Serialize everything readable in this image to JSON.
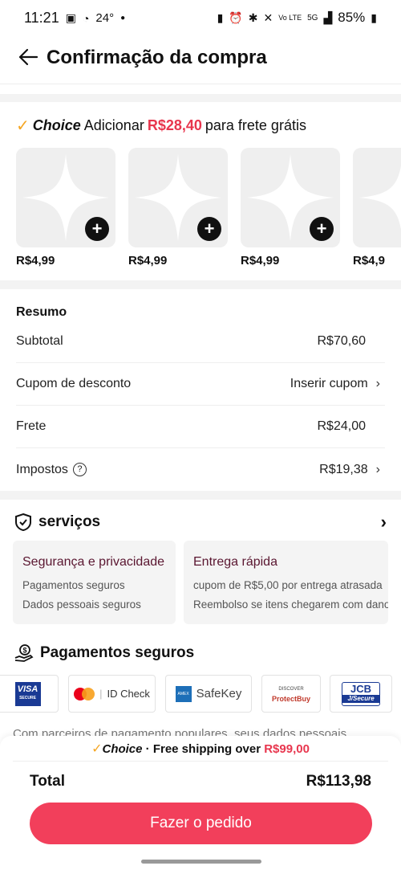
{
  "status_bar": {
    "time": "11:21",
    "temperature": "24°",
    "battery": "85%",
    "network": "5G"
  },
  "header": {
    "title": "Confirmação da compra"
  },
  "choice_banner": {
    "brand": "Choice",
    "prefix": "Adicionar",
    "amount": "R$28,40",
    "suffix": "para frete grátis"
  },
  "products": [
    {
      "price": "R$4,99"
    },
    {
      "price": "R$4,99"
    },
    {
      "price": "R$4,99"
    },
    {
      "price": "R$4,9"
    }
  ],
  "summary": {
    "title": "Resumo",
    "rows": [
      {
        "label": "Subtotal",
        "value": "R$70,60"
      },
      {
        "label": "Cupom de desconto",
        "value": "Inserir cupom"
      },
      {
        "label": "Frete",
        "value": "R$24,00"
      },
      {
        "label": "Impostos",
        "value": "R$19,38"
      }
    ]
  },
  "services": {
    "title": "serviços",
    "cards": [
      {
        "title": "Segurança e privacidade",
        "lines": [
          "Pagamentos seguros",
          "Dados pessoais seguros"
        ]
      },
      {
        "title": "Entrega rápida",
        "lines": [
          "cupom de R$5,00 por entrega atrasada",
          "Reembolso se itens chegarem com dano"
        ]
      }
    ]
  },
  "payments": {
    "title": "Pagamentos seguros",
    "logos": {
      "visa": "VISA",
      "visa_sub": "SECURE",
      "mastercard": "ID Check",
      "amex": "SafeKey",
      "discover_top": "DISCOVER",
      "discover": "ProtectBuy",
      "jcb": "JCB",
      "jcb_sub": "J/Secure"
    },
    "description": "Com parceiros de pagamento populares, seus dados pessoais"
  },
  "footer": {
    "brand": "Choice",
    "shipping_text": "· Free shipping over",
    "shipping_amount": "R$99,00",
    "total_label": "Total",
    "total_value": "R$113,98",
    "order_button": "Fazer o pedido"
  },
  "colors": {
    "accent": "#f23f5b",
    "price_red": "#e8364e",
    "choice_check": "#f5a623"
  }
}
